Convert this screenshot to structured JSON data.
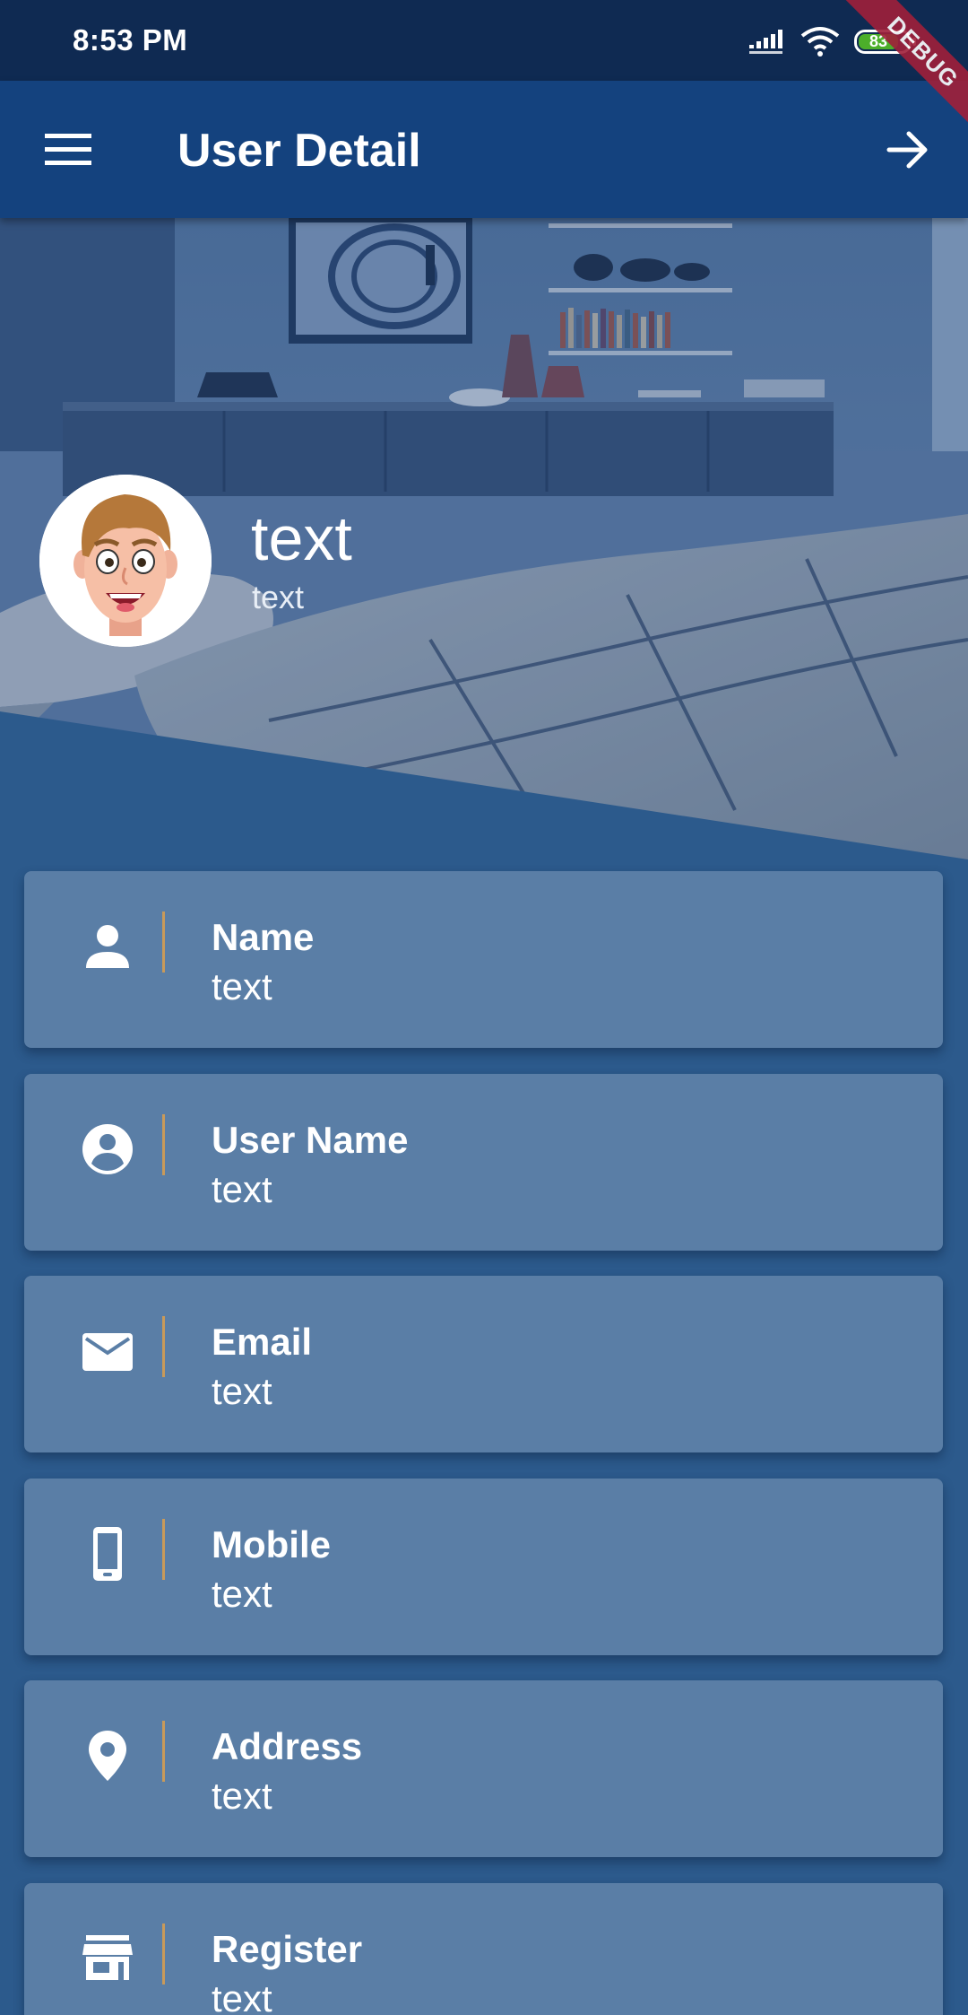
{
  "status_bar": {
    "time": "8:53 PM",
    "battery": "83",
    "debug_label": "DEBUG"
  },
  "app_bar": {
    "title": "User Detail",
    "menu_icon": "menu-icon",
    "action_icon": "arrow-forward-icon"
  },
  "profile": {
    "name": "text",
    "subtitle": "text"
  },
  "details": [
    {
      "label": "Name",
      "value": "text",
      "icon": "person-icon"
    },
    {
      "label": "User Name",
      "value": "text",
      "icon": "account-circle-icon"
    },
    {
      "label": "Email",
      "value": "text",
      "icon": "email-icon"
    },
    {
      "label": "Mobile",
      "value": "text",
      "icon": "phone-icon"
    },
    {
      "label": "Address",
      "value": "text",
      "icon": "location-pin-icon"
    },
    {
      "label": "Register",
      "value": "text",
      "icon": "store-icon"
    }
  ],
  "colors": {
    "app_bar": "#14427e",
    "status_bar": "#0f2a52",
    "background": "#2c5a8c",
    "card": "#5a7ea6",
    "divider": "#c89a5a"
  }
}
